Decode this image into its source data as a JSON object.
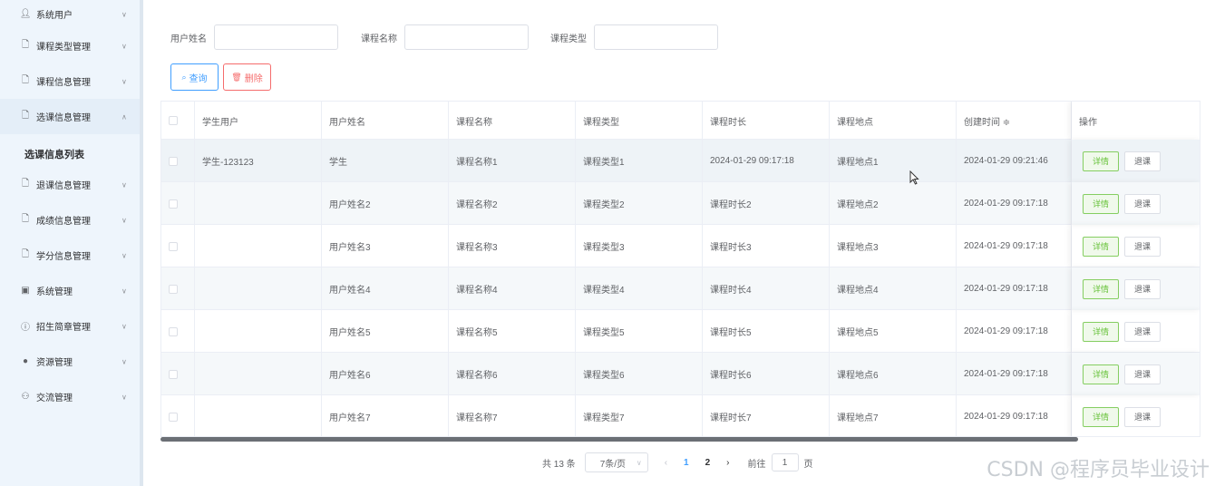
{
  "sidebar": {
    "items": [
      {
        "label": "系统用户",
        "icon": "user-icon",
        "open": false
      },
      {
        "label": "课程类型管理",
        "icon": "file-icon",
        "open": false
      },
      {
        "label": "课程信息管理",
        "icon": "file-icon",
        "open": false
      },
      {
        "label": "选课信息管理",
        "icon": "file-icon",
        "open": true
      },
      {
        "label": "退课信息管理",
        "icon": "file-icon",
        "open": false
      },
      {
        "label": "成绩信息管理",
        "icon": "file-icon",
        "open": false
      },
      {
        "label": "学分信息管理",
        "icon": "file-icon",
        "open": false
      },
      {
        "label": "系统管理",
        "icon": "picture-icon",
        "open": false
      },
      {
        "label": "招生简章管理",
        "icon": "info-icon",
        "open": false
      },
      {
        "label": "资源管理",
        "icon": "location-icon",
        "open": false
      },
      {
        "label": "交流管理",
        "icon": "chat-icon",
        "open": false
      }
    ],
    "active_sub": "选课信息列表"
  },
  "search": {
    "user_name_label": "用户姓名",
    "course_name_label": "课程名称",
    "course_type_label": "课程类型",
    "query_label": "查询",
    "delete_label": "删除"
  },
  "table": {
    "headers": [
      "学生用户",
      "用户姓名",
      "课程名称",
      "课程类型",
      "课程时长",
      "课程地点",
      "创建时间 ≑",
      "操作"
    ],
    "detail_label": "详情",
    "quit_label": "退课",
    "rows": [
      [
        "学生-123123",
        "学生",
        "课程名称1",
        "课程类型1",
        "2024-01-29 09:17:18",
        "课程地点1",
        "2024-01-29 09:21:46"
      ],
      [
        "",
        "用户姓名2",
        "课程名称2",
        "课程类型2",
        "课程时长2",
        "课程地点2",
        "2024-01-29 09:17:18"
      ],
      [
        "",
        "用户姓名3",
        "课程名称3",
        "课程类型3",
        "课程时长3",
        "课程地点3",
        "2024-01-29 09:17:18"
      ],
      [
        "",
        "用户姓名4",
        "课程名称4",
        "课程类型4",
        "课程时长4",
        "课程地点4",
        "2024-01-29 09:17:18"
      ],
      [
        "",
        "用户姓名5",
        "课程名称5",
        "课程类型5",
        "课程时长5",
        "课程地点5",
        "2024-01-29 09:17:18"
      ],
      [
        "",
        "用户姓名6",
        "课程名称6",
        "课程类型6",
        "课程时长6",
        "课程地点6",
        "2024-01-29 09:17:18"
      ],
      [
        "",
        "用户姓名7",
        "课程名称7",
        "课程类型7",
        "课程时长7",
        "课程地点7",
        "2024-01-29 09:17:18"
      ]
    ]
  },
  "pagination": {
    "total": "共 13 条",
    "page_size": "7条/页",
    "pages": [
      "1",
      "2"
    ],
    "active_page": "1",
    "goto_prefix": "前往",
    "goto_value": "1",
    "goto_suffix": "页"
  },
  "watermark": "CSDN @程序员毕业设计"
}
